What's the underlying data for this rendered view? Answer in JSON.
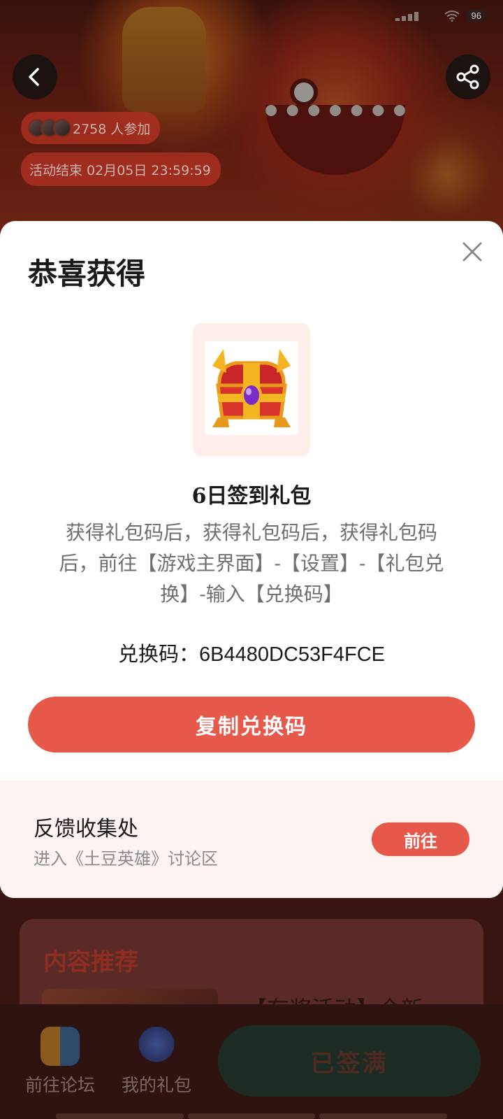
{
  "status_bar": {
    "battery": "96"
  },
  "header": {
    "participants": "2758 人参加",
    "event_end": "活动结束 02月05日 23:59:59"
  },
  "modal": {
    "title": "恭喜获得",
    "gift_name": "6日签到礼包",
    "description": "获得礼包码后，获得礼包码后，获得礼包码后，前往【游戏主界面】-【设置】-【礼包兑换】-输入【兑换码】",
    "code_label": "兑换码：",
    "code_value": "6B4480DC53F4FCE",
    "copy_button": "复制兑换码",
    "feedback": {
      "title": "反馈收集处",
      "subtitle": "进入《土豆英雄》讨论区",
      "button": "前往"
    }
  },
  "recommend": {
    "title": "内容推荐",
    "item_title": "【有奖活动】全新"
  },
  "bottom_bar": {
    "forum_label": "前往论坛",
    "gifts_label": "我的礼包",
    "signed_button": "已签满"
  },
  "colors": {
    "accent": "#e5584a",
    "feedback_bg": "#fdf3f1",
    "gift_frame_bg": "#fdeeea"
  }
}
